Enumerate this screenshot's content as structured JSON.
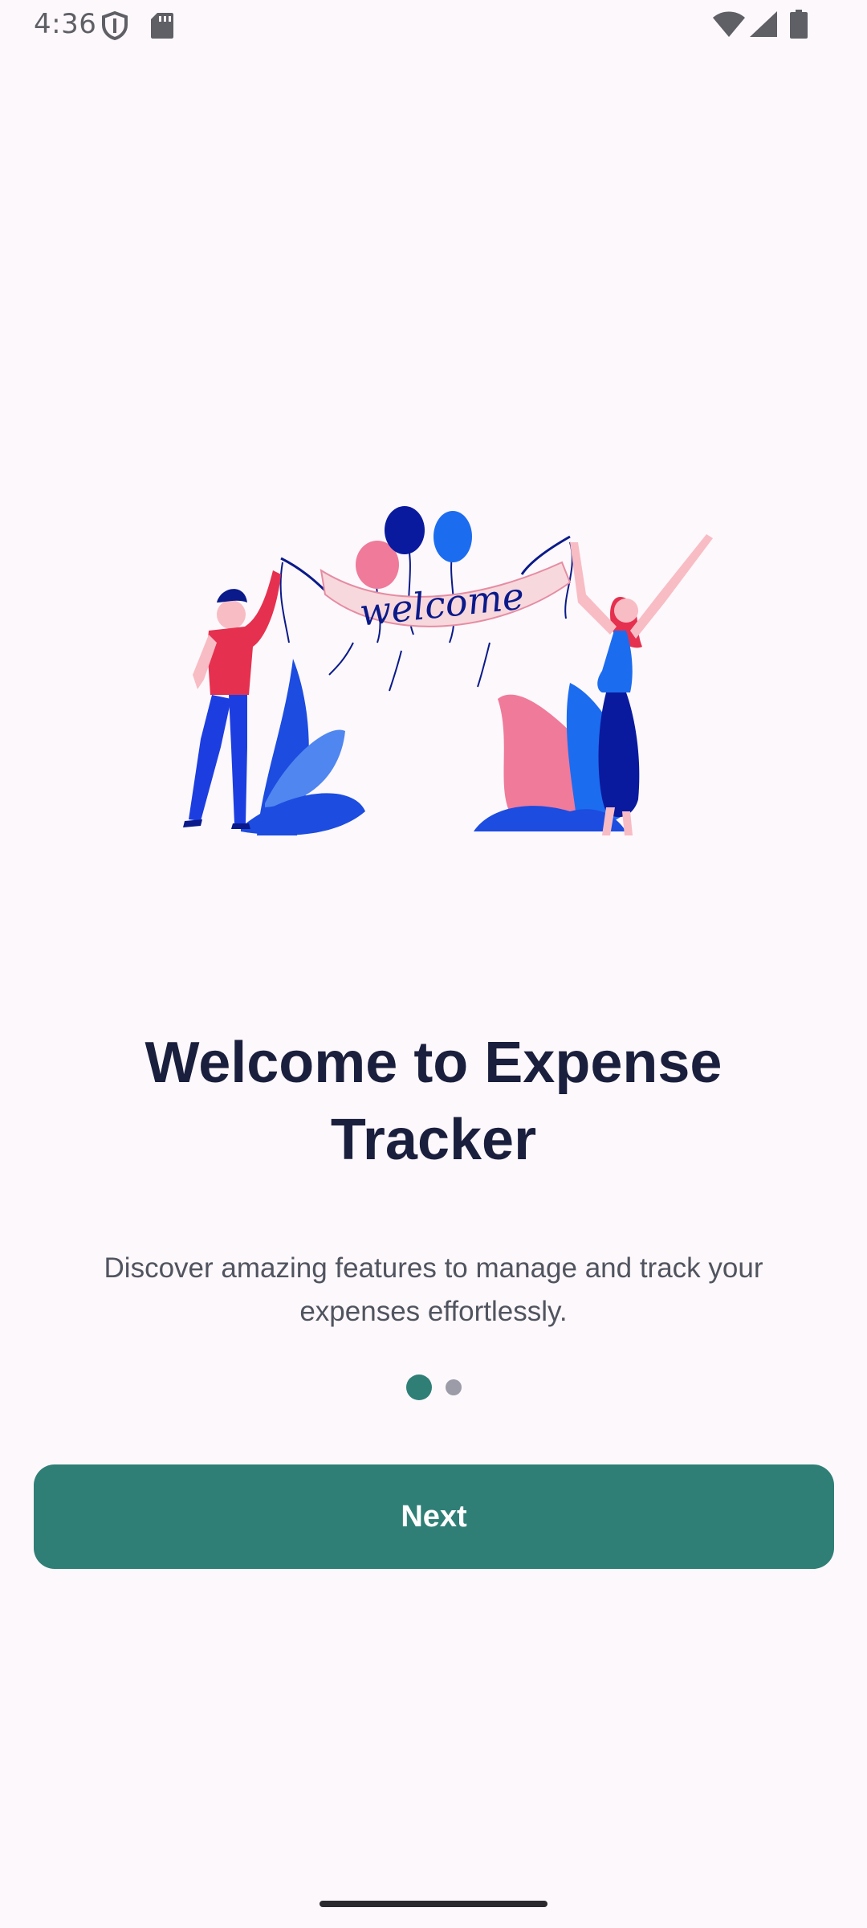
{
  "status_bar": {
    "time": "4:36",
    "icons": [
      "shield-icon",
      "sd-card-icon",
      "wifi-icon",
      "signal-icon",
      "battery-icon"
    ]
  },
  "illustration": {
    "banner_text": "welcome"
  },
  "onboarding": {
    "title": "Welcome to Expense Tracker",
    "subtitle": "Discover amazing features to manage and track your expenses effortlessly.",
    "page_count": 2,
    "current_page": 1
  },
  "actions": {
    "next_label": "Next"
  },
  "colors": {
    "background": "#fdf8fb",
    "primary": "#2f7f77",
    "title": "#1a1f3d",
    "subtitle": "#50545f",
    "indicator_inactive": "#9b9ca8"
  }
}
